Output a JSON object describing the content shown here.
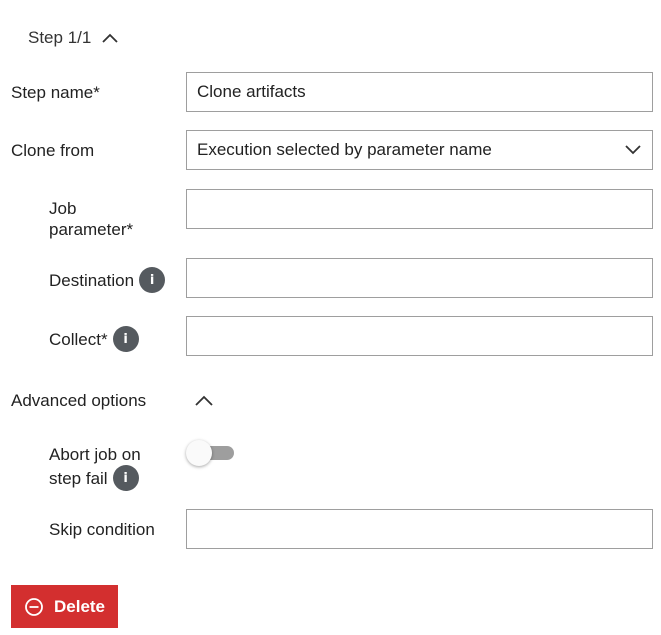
{
  "step": {
    "title": "Step 1/1",
    "chevron_icon": "chevron-up-icon"
  },
  "form": {
    "step_name": {
      "label": "Step name*",
      "value": "Clone artifacts"
    },
    "clone_from": {
      "label": "Clone from",
      "value": "Execution selected by parameter name",
      "chevron_icon": "chevron-down-icon"
    },
    "job_parameter": {
      "label_line1": "Job",
      "label_line2": "parameter*",
      "value": ""
    },
    "destination": {
      "label": "Destination",
      "value": "",
      "info_icon": "info-icon",
      "info_glyph": "i"
    },
    "collect": {
      "label": "Collect*",
      "value": "",
      "info_icon": "info-icon",
      "info_glyph": "i"
    }
  },
  "advanced": {
    "label": "Advanced options",
    "chevron_icon": "chevron-up-icon",
    "abort_job": {
      "label_line1": "Abort job on",
      "label_line2": "step fail",
      "enabled": false,
      "info_icon": "info-icon",
      "info_glyph": "i"
    },
    "skip_condition": {
      "label": "Skip condition",
      "value": ""
    }
  },
  "delete_button": {
    "label": "Delete",
    "icon": "minus-circle-icon",
    "color": "#d32f2f"
  }
}
